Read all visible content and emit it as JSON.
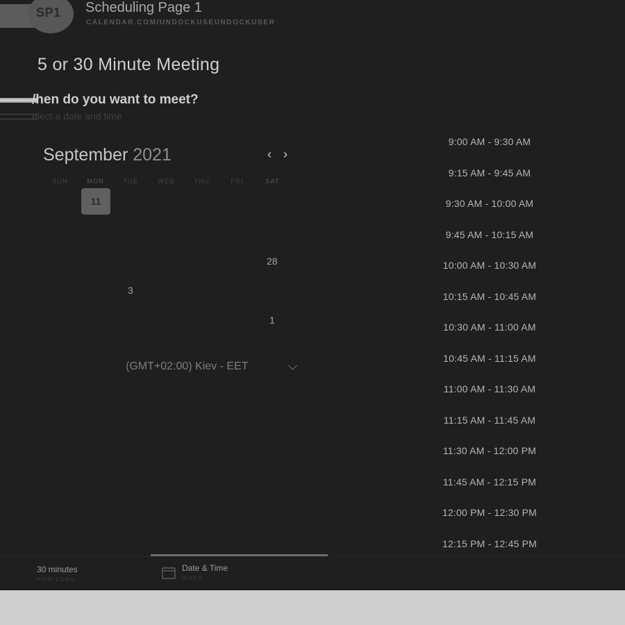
{
  "header": {
    "badge": "SP1",
    "page_name": "Scheduling Page 1",
    "url": "CALENDAR.COM/UNDOCKUSEUNDOCKUSER"
  },
  "meeting": {
    "title": "5 or 30 Minute Meeting",
    "question": "/hen do you want to meet?",
    "subtitle": "elect a date and time"
  },
  "calendar": {
    "month": "September",
    "year": "2021",
    "prev_icon": "chevron-left-icon",
    "next_icon": "chevron-right-icon",
    "weekdays": [
      "SUN",
      "MON",
      "TUE",
      "WED",
      "THU",
      "FRI",
      "SAT"
    ],
    "selected_day": "11",
    "visible_days": [
      "28",
      "3",
      "1"
    ]
  },
  "timezone": {
    "label": "(GMT+02:00) Kiev - EET"
  },
  "time_slots": [
    "9:00 AM - 9:30 AM",
    "9:15 AM - 9:45 AM",
    "9:30 AM - 10:00 AM",
    "9:45 AM - 10:15 AM",
    "10:00 AM - 10:30 AM",
    "10:15 AM - 10:45 AM",
    "10:30 AM - 11:00 AM",
    "10:45 AM - 11:15 AM",
    "11:00 AM - 11:30 AM",
    "11:15 AM - 11:45 AM",
    "11:30 AM - 12:00 PM",
    "11:45 AM - 12:15 PM",
    "12:00 PM - 12:30 PM",
    "12:15 PM - 12:45 PM"
  ],
  "footer": {
    "duration": "30 minutes",
    "duration_label": "HOW LONG",
    "datetime": "Date & Time",
    "datetime_label": "WHEN",
    "datetime_icon": "calendar-icon"
  }
}
